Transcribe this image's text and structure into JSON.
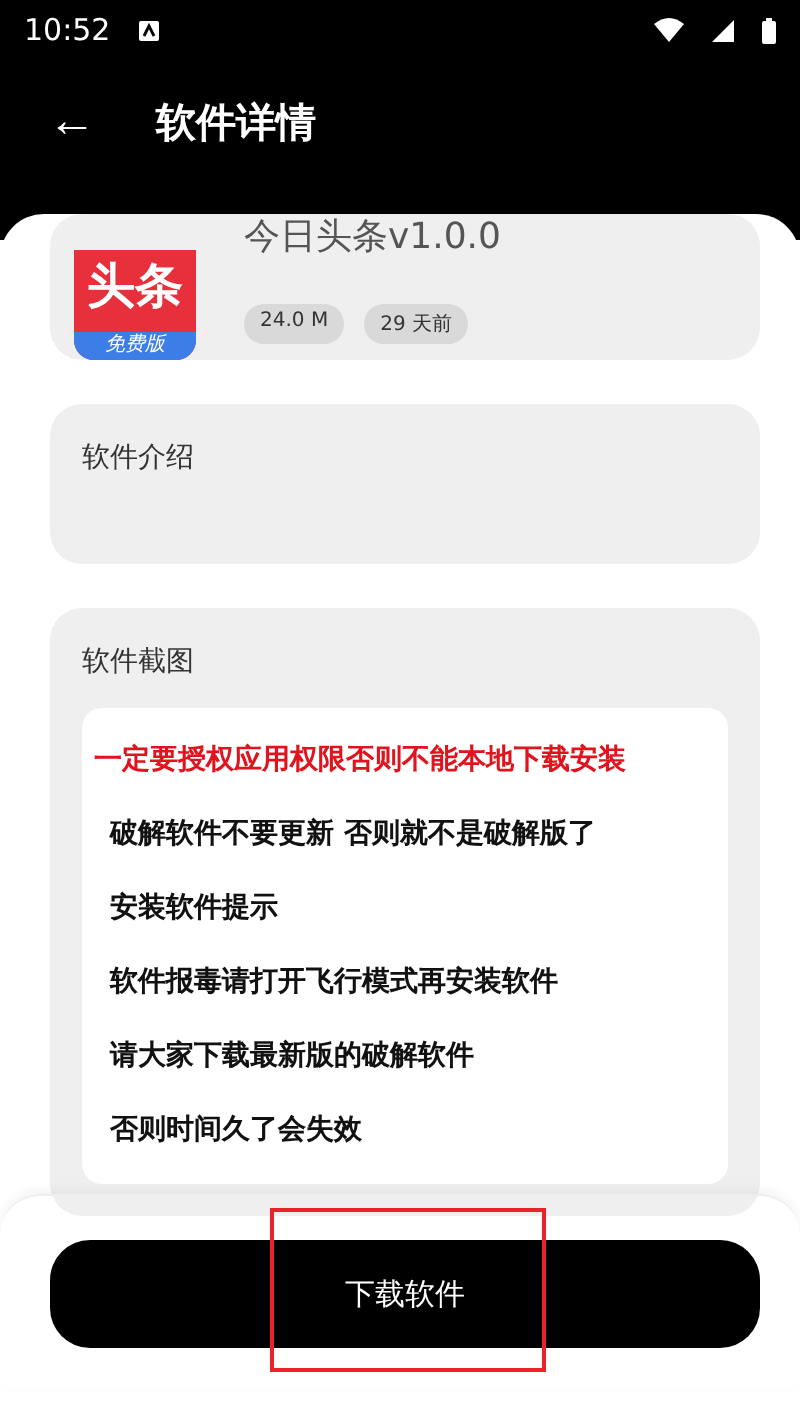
{
  "status_bar": {
    "time": "10:52"
  },
  "header": {
    "back": "←",
    "title": "软件详情"
  },
  "app": {
    "name": "今日头条v1.0.0",
    "icon_text": "头条",
    "icon_badge": "免费版",
    "tags": [
      "24.0 M",
      "29 天前"
    ]
  },
  "intro": {
    "title": "软件介绍"
  },
  "screenshots": {
    "title": "软件截图",
    "lines": [
      {
        "text": "一定要授权应用权限否则不能本地下载安装",
        "kind": "warning"
      },
      {
        "text": "破解软件不要更新 否则就不是破解版了",
        "kind": "normal"
      },
      {
        "text": "安装软件提示",
        "kind": "normal"
      },
      {
        "text": "软件报毒请打开飞行模式再安装软件",
        "kind": "normal"
      },
      {
        "text": "请大家下载最新版的破解软件",
        "kind": "normal"
      },
      {
        "text": "否则时间久了会失效",
        "kind": "normal"
      }
    ]
  },
  "download_button": "下载软件"
}
